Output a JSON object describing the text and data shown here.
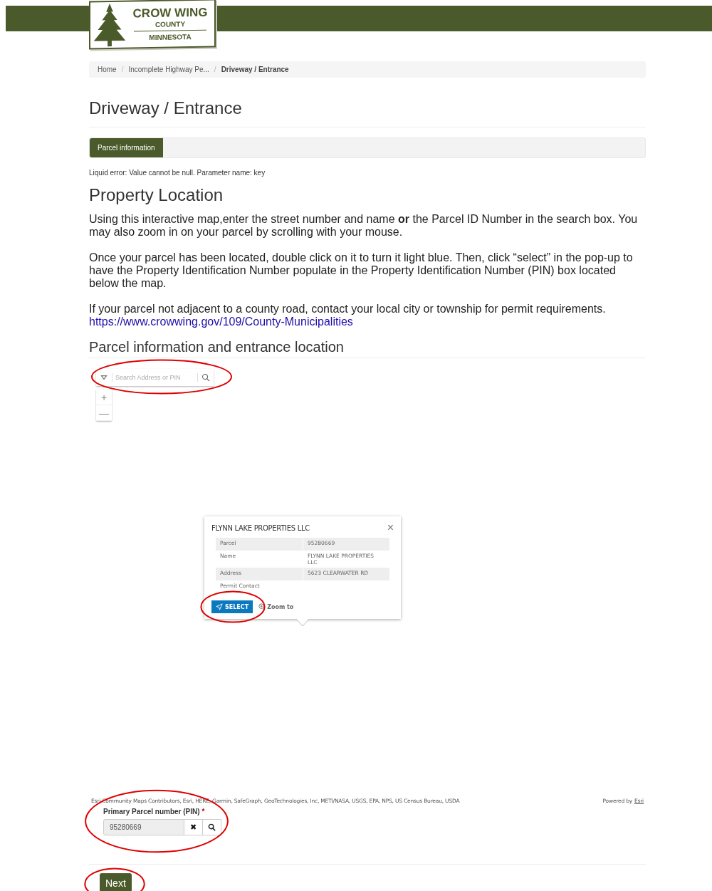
{
  "logo": {
    "lines": [
      "CROW WING",
      "COUNTY",
      "MINNESOTA"
    ]
  },
  "breadcrumb_separator": "/",
  "breadcrumb": [
    {
      "label": "Home",
      "current": false
    },
    {
      "label": "Incomplete Highway Pe...",
      "current": false
    },
    {
      "label": "Driveway / Entrance",
      "current": true
    }
  ],
  "page_title": "Driveway / Entrance",
  "tabs": [
    {
      "label": "Parcel information",
      "selected": true
    }
  ],
  "error_text": "Liquid error: Value cannot be null. Parameter name: key",
  "section_title": "Property Location",
  "paragraphs": [
    "Using this interactive map,enter the street number and name **or** the Parcel ID Number in the search box. You may also zoom in on your parcel by scrolling with your mouse.",
    "Once your parcel has been located, double click on it to turn it light blue.  Then, click “select” in the pop-up to have the Property Identification Number populate in the Property Identification Number (PIN) box located below the map.",
    "If your parcel not adjacent to a county road, contact your local city or township for permit requirements."
  ],
  "link": "https://www.crowwing.gov/109/County-Municipalities",
  "map_heading": "Parcel information and entrance location",
  "map": {
    "search": {
      "placeholder": "Search Address or PIN",
      "circled": true
    },
    "zoom_in": "+",
    "zoom_out": "—",
    "popup": {
      "title": "FLYNN LAKE PROPERTIES LLC",
      "close": "×",
      "rows": [
        {
          "label": "Parcel",
          "value": "95280669"
        },
        {
          "label": "Name",
          "value": "FLYNN LAKE PROPERTIES LLC"
        },
        {
          "label": "Address",
          "value": "5623 CLEARWATER RD"
        },
        {
          "label": "Permit Contact"
        }
      ],
      "select_button": "SELECT",
      "select_circled": true,
      "zoom_to": "Zoom to"
    },
    "attribution": "Esri Community Maps Contributors, Esri, HERE, Garmin, SafeGraph, GeoTechnologies, Inc, METI/NASA, USGS, EPA, NPS, US Census Bureau, USDA",
    "powered_by": "Powered by",
    "powered_link": "Esri"
  },
  "pin_field": {
    "label": "Primary Parcel number (PIN)",
    "required_mark": "*",
    "value": "95280669",
    "clear": "✖",
    "circled": true
  },
  "next_button": {
    "label": "Next",
    "circled": true
  }
}
